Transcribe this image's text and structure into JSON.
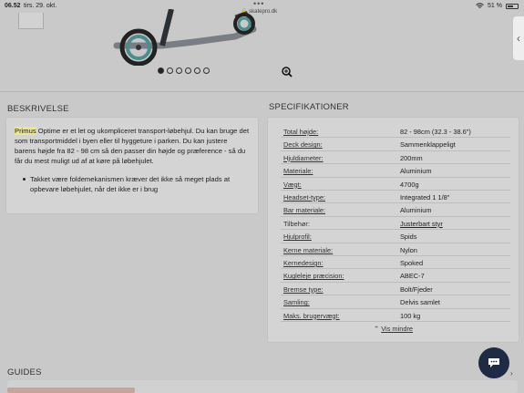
{
  "status_bar": {
    "time": "06.52",
    "date": "tirs. 29. okt.",
    "url": "skatepro.dk",
    "battery": "51 %"
  },
  "carousel": {
    "count": 6,
    "active_index": 0
  },
  "description": {
    "heading": "BESKRIVELSE",
    "highlight": "Primus",
    "text": " Optime er et let og ukompliceret transport-løbehjul. Du kan bruge det som transportmiddel i byen eller til hyggeture i parken. Du kan justere barens højde fra 82 - 98 cm så den passer din højde og præference - så du får du mest muligt ud af at køre på løbehjulet.",
    "bullet": "Takket være foldemekanismen kræver det ikke så meget plads at opbevare løbehjulet, når det ikke er i brug"
  },
  "specs": {
    "heading": "SPECIFIKATIONER",
    "rows": [
      {
        "k": "Total højde:",
        "v": "82 - 98cm (32.3 - 38.6\")"
      },
      {
        "k": "Deck design:",
        "v": "Sammenklappeligt"
      },
      {
        "k": "Hjuldiameter:",
        "v": "200mm"
      },
      {
        "k": "Materiale:",
        "v": "Aluminium"
      },
      {
        "k": "Vægt:",
        "v": "4700g"
      },
      {
        "k": "Headset-type:",
        "v": "Integrated 1 1/8\""
      },
      {
        "k": "Bar materiale:",
        "v": "Aluminium"
      },
      {
        "k": "Tilbehør:",
        "v": "Justerbart styr"
      },
      {
        "k": "Hjulprofil:",
        "v": "Spids"
      },
      {
        "k": "Kerne materiale:",
        "v": "Nylon"
      },
      {
        "k": "Kernedesign:",
        "v": "Spoked"
      },
      {
        "k": "Kugleleje præcision:",
        "v": "ABEC-7"
      },
      {
        "k": "Bremse type:",
        "v": "Bolt/Fjeder"
      },
      {
        "k": "Samling:",
        "v": "Delvis samlet"
      },
      {
        "k": "Maks. brugervægt:",
        "v": "100 kg"
      }
    ],
    "show_less": "Vis mindre"
  },
  "guides": {
    "heading": "GUIDES"
  },
  "icons": [
    "wifi-icon",
    "battery-icon",
    "zoom-icon",
    "chat-icon",
    "chevron-left-icon"
  ]
}
